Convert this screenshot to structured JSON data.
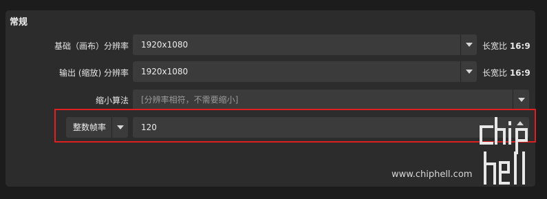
{
  "section": {
    "title": "常规"
  },
  "base_resolution": {
    "label": "基础（画布）分辨率",
    "value": "1920x1080",
    "aspect_prefix": "长宽比 ",
    "aspect_value": "16:9"
  },
  "output_resolution": {
    "label": "输出 (缩放) 分辨率",
    "value": "1920x1080",
    "aspect_prefix": "长宽比 ",
    "aspect_value": "16:9"
  },
  "downscale_filter": {
    "label": "缩小算法",
    "value": "[分辨率相符，不需要缩小]"
  },
  "fps": {
    "type_value": "整数帧率",
    "value": "120"
  },
  "watermark": {
    "text": "www.chiphell.com",
    "logo_text": "chiphell"
  },
  "colors": {
    "highlight": "#e02020",
    "panel": "#2c2c2c",
    "field": "#3b3b3b"
  }
}
